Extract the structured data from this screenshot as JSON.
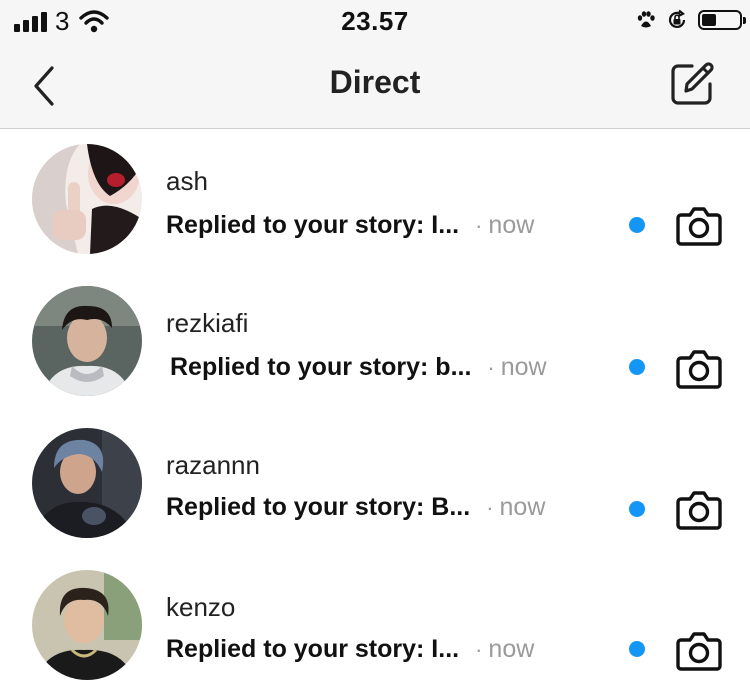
{
  "status_bar": {
    "carrier": "3",
    "time": "23.57",
    "icons": [
      "signal-bars-icon",
      "wifi-icon",
      "paw-icon",
      "rotation-lock-icon",
      "battery-icon"
    ]
  },
  "header": {
    "title": "Direct",
    "back_icon": "chevron-left-icon",
    "compose_icon": "new-message-icon"
  },
  "conversations": [
    {
      "username": "ash",
      "message": "Replied to your story: I...",
      "separator": "·",
      "time": "now",
      "unread": true
    },
    {
      "username": "rezkiafi",
      "message": "Replied to your story: b...",
      "separator": "·",
      "time": "now",
      "unread": true
    },
    {
      "username": "razannn",
      "message": "Replied to your story: B...",
      "separator": "·",
      "time": "now",
      "unread": true
    },
    {
      "username": "kenzo",
      "message": "Replied to your story: I...",
      "separator": "·",
      "time": "now",
      "unread": true
    }
  ],
  "colors": {
    "unread_dot": "#1496f7",
    "header_bg": "#f6f6f6",
    "timestamp": "#9a9a9a"
  }
}
